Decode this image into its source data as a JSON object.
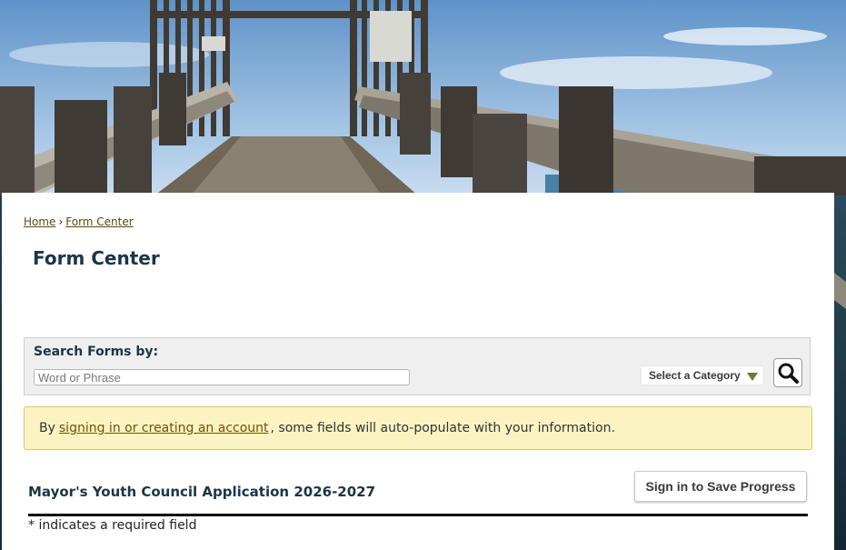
{
  "breadcrumb": {
    "home": "Home",
    "separator": "›",
    "current": "Form Center"
  },
  "page": {
    "title": "Form Center"
  },
  "search": {
    "label": "Search Forms by:",
    "placeholder": "Word or Phrase",
    "category_label": "Select a Category",
    "button_icon": "magnifier-icon"
  },
  "notice": {
    "prefix": "By",
    "link_text": "signing in or creating an account",
    "suffix": ", some fields will auto-populate with your information.",
    "background_color": "#fbf3c1"
  },
  "form": {
    "title": "Mayor's Youth Council Application 2026-2027",
    "save_button": "Sign in to Save Progress",
    "required_note": "* indicates a required field"
  },
  "colors": {
    "heading": "#1c3547",
    "link": "#5b4a12",
    "page_side": "#1b3442"
  }
}
